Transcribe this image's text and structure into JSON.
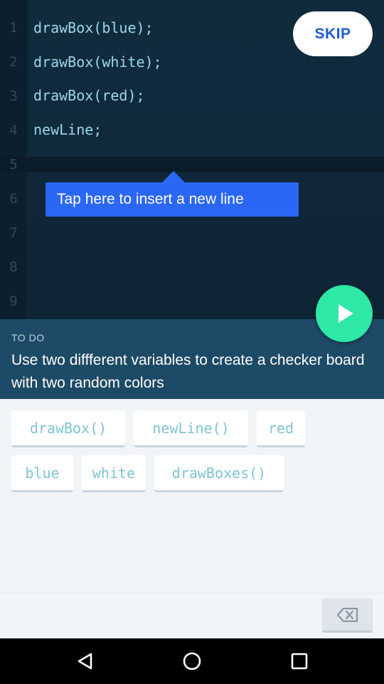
{
  "editor": {
    "line_numbers": [
      "1",
      "2",
      "3",
      "4",
      "5",
      "6",
      "7",
      "8",
      "9"
    ],
    "code_lines": [
      "drawBox(blue);",
      "drawBox(white);",
      "drawBox(red);",
      "newLine;"
    ]
  },
  "skip_label": "SKIP",
  "tooltip_text": "Tap here to insert a new line",
  "todo": {
    "heading": "TO DO",
    "text": "Use two diffferent variables to create a checker board with two random colors"
  },
  "tokens": [
    "drawBox()",
    "newLine()",
    "red",
    "blue",
    "white",
    "drawBoxes()"
  ],
  "colors": {
    "accent_blue": "#2a67f5",
    "play_green": "#2ee8a5",
    "code_text": "#9fd6ea",
    "todo_bg": "#1d4a66"
  },
  "icons": {
    "play": "play-icon",
    "backspace": "backspace-icon",
    "nav_back": "back-triangle-icon",
    "nav_home": "home-circle-icon",
    "nav_recents": "recents-square-icon"
  }
}
